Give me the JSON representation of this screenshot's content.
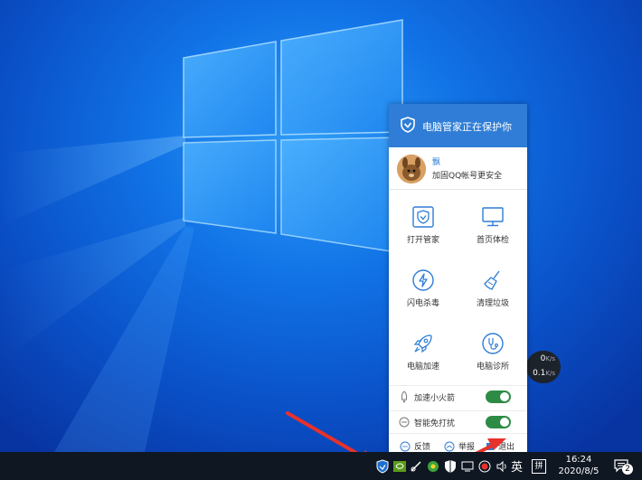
{
  "popup": {
    "header_title": "电脑管家正在保护你",
    "user_name": "飘",
    "user_hint": "加固QQ帐号更安全",
    "grid": [
      {
        "label": "打开管家",
        "icon": "shield-icon"
      },
      {
        "label": "首页体检",
        "icon": "monitor-icon"
      },
      {
        "label": "闪电杀毒",
        "icon": "lightning-icon"
      },
      {
        "label": "清理垃圾",
        "icon": "broom-icon"
      },
      {
        "label": "电脑加速",
        "icon": "rocket-icon"
      },
      {
        "label": "电脑诊所",
        "icon": "stethoscope-icon"
      }
    ],
    "toggles": [
      {
        "label": "加速小火箭",
        "on": true
      },
      {
        "label": "智能免打扰",
        "on": true
      }
    ],
    "bottom": {
      "feedback": "反馈",
      "report": "举报",
      "exit": "退出"
    }
  },
  "netspeed": {
    "down_value": "0",
    "up_value": "0.1",
    "unit": "K/s"
  },
  "taskbar": {
    "lang": "英",
    "ime": "拼",
    "time": "16:24",
    "date": "2020/8/5",
    "notification_count": "2"
  },
  "colors": {
    "accent": "#2f7dd6",
    "toggle_on": "#2e8b46",
    "arrow": "#e8312b"
  }
}
